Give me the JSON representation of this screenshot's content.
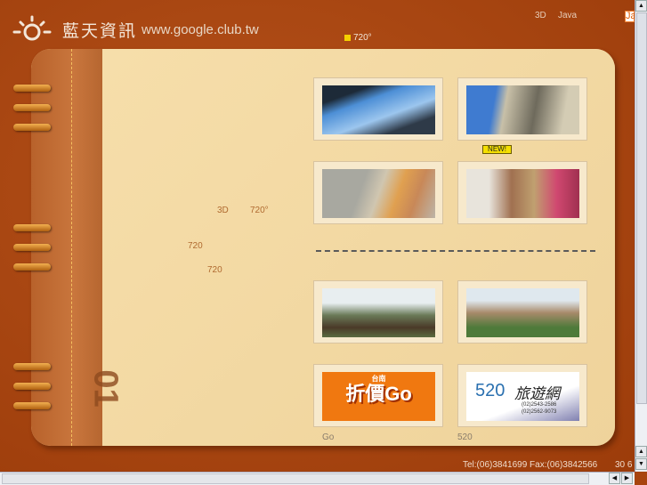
{
  "header": {
    "site_name": "藍天資訊",
    "url": "www.google.club.tw",
    "links": [
      "3D",
      "Java"
    ],
    "ja_badge": "Ja",
    "marquee": "720°"
  },
  "page": {
    "texts": [
      "3D",
      "720°",
      "720",
      "720"
    ],
    "new_badge": "NEW!",
    "chapter_number": "01"
  },
  "gallery": {
    "captions": [
      "Go",
      "520"
    ],
    "banner1": {
      "small": "台南",
      "main": "折價Go"
    },
    "banner2": {
      "num": "520",
      "name": "旅遊網",
      "phone1": "(02)2543-2586",
      "phone2": "(02)2562-9073"
    }
  },
  "footer": {
    "contact": "Tel:(06)3841699 Fax:(06)3842566",
    "extra": "30 6"
  },
  "colors": {
    "background": "#a8440e",
    "page": "#f2d8a2",
    "new_badge": "#f5e000"
  }
}
